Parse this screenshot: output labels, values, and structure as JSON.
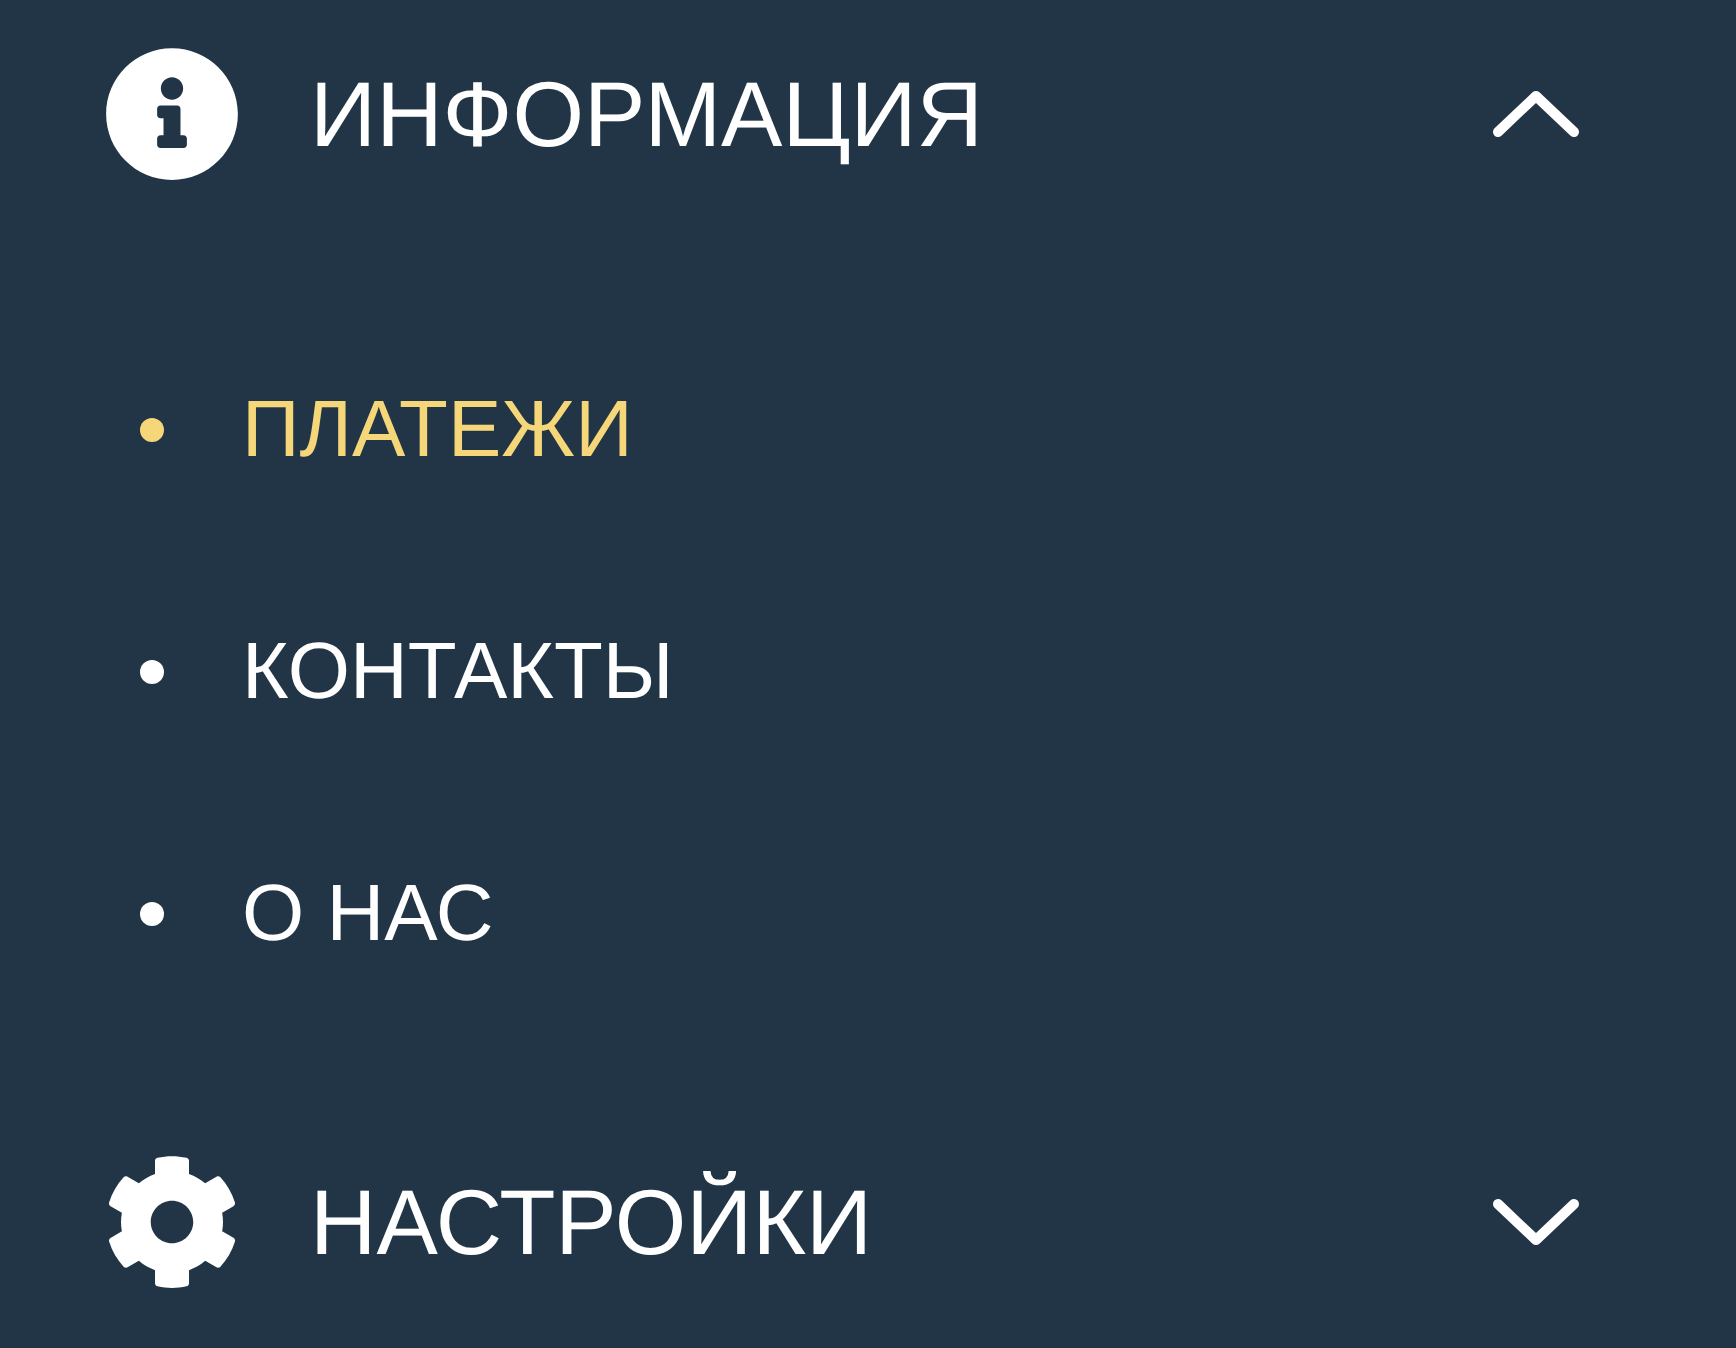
{
  "sections": [
    {
      "kind": "info",
      "title": "ИНФОРМАЦИЯ",
      "expanded": true,
      "items": [
        {
          "label": "ПЛАТЕЖИ",
          "selected": true
        },
        {
          "label": "КОНТАКТЫ",
          "selected": false
        },
        {
          "label": "О НАС",
          "selected": false
        }
      ]
    },
    {
      "kind": "settings",
      "title": "НАСТРОЙКИ",
      "expanded": false
    }
  ]
}
